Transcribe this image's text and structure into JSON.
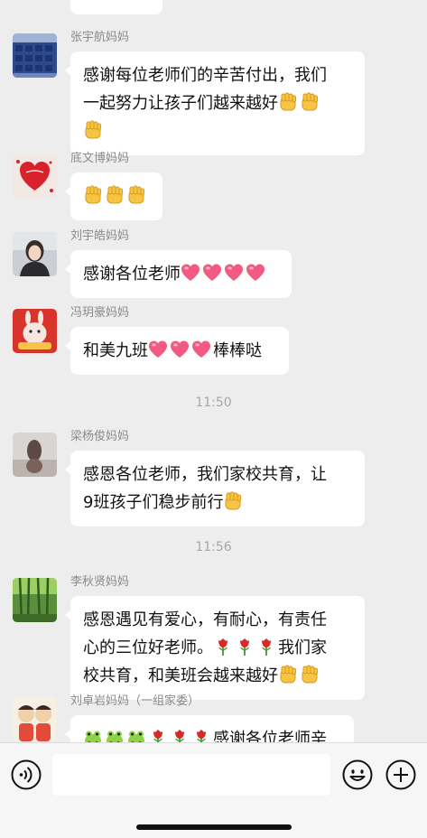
{
  "messages": [
    {
      "sender": "张宇航妈妈",
      "lines": [
        "感谢每位老师们的辛苦付出，我们",
        "一起努力让孩子们越来越好"
      ],
      "icons": [
        "fist-emoji",
        "fist-emoji",
        "fist-emoji"
      ]
    },
    {
      "sender": "底文博妈妈",
      "lines": [
        ""
      ],
      "icons": [
        "fist-emoji",
        "fist-emoji",
        "fist-emoji"
      ]
    },
    {
      "sender": "刘宇皓妈妈",
      "lines": [
        "感谢各位老师"
      ],
      "icons": [
        "heart-emoji",
        "heart-emoji",
        "heart-emoji",
        "heart-emoji"
      ]
    },
    {
      "sender": "冯玥豪妈妈",
      "lines": [
        "和美九班",
        "棒棒哒"
      ],
      "icons": [
        "heart-emoji",
        "heart-emoji",
        "heart-emoji"
      ]
    },
    {
      "sender": "梁杨俊妈妈",
      "lines": [
        "感恩各位老师，我们家校共育，让",
        "9班孩子们稳步前行"
      ],
      "icons": [
        "fist-emoji"
      ]
    },
    {
      "sender": "李秋贤妈妈",
      "lines": [
        "感恩遇见有爱心，有耐心，有责任",
        "心的三位好老师。",
        "我们家",
        "校共育，和美班会越来越好"
      ],
      "icons": [
        "rose-emoji",
        "rose-emoji",
        "rose-emoji",
        "fist-emoji",
        "fist-emoji"
      ]
    },
    {
      "sender": "刘卓岩妈妈（一组家委）",
      "lines": [
        "感谢各位老师辛"
      ],
      "icons": [
        "frog-emoji",
        "frog-emoji",
        "frog-emoji",
        "rose-emoji",
        "rose-emoji",
        "rose-emoji"
      ]
    }
  ],
  "timestamps": [
    "11:50",
    "11:56"
  ],
  "input_bar": {
    "icons": [
      "voice-icon",
      "emoji-face-icon",
      "plus-icon"
    ]
  },
  "colors": {
    "background": "#ededed",
    "bubble": "#ffffff",
    "sender_text": "#8a8a8a",
    "timestamp_text": "#a7a7a7"
  }
}
